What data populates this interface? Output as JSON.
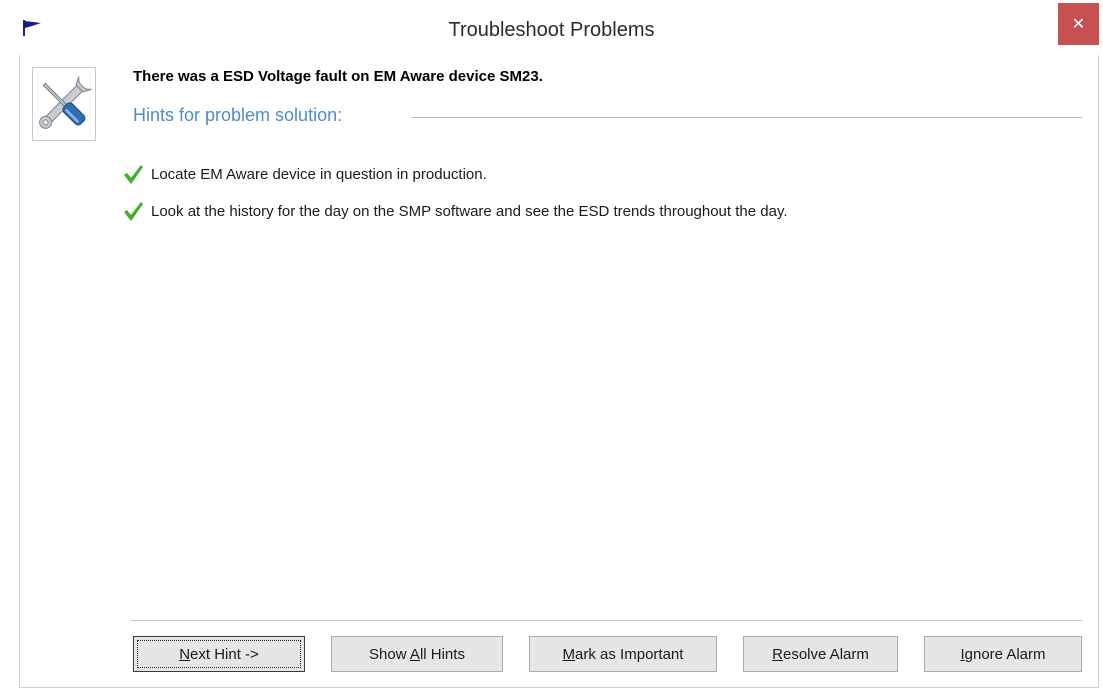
{
  "window": {
    "title": "Troubleshoot Problems",
    "close_glyph": "✕"
  },
  "icons": {
    "app": "flag-icon",
    "problem": "tools-icon",
    "hint_marker": "checkmark-icon"
  },
  "colors": {
    "hints_header": "#4f8cc9",
    "check": "#3fae2a",
    "close_bg": "#c75050",
    "flag": "#1a1a8c"
  },
  "problem": {
    "headline": "There was a ESD Voltage fault on EM Aware device SM23."
  },
  "hints": {
    "header": "Hints for problem solution:",
    "items": [
      "Locate EM Aware device in question in production.",
      "Look at the history for the day on the SMP software and see the ESD trends throughout the day."
    ]
  },
  "buttons": {
    "next_hint": {
      "pre": "",
      "key": "N",
      "post": "ext Hint ->"
    },
    "show_all_hints": {
      "pre": "Show ",
      "key": "A",
      "post": "ll Hints"
    },
    "mark_important": {
      "pre": "",
      "key": "M",
      "post": "ark as Important"
    },
    "resolve_alarm": {
      "pre": "",
      "key": "R",
      "post": "esolve Alarm"
    },
    "ignore_alarm": {
      "pre": "",
      "key": "I",
      "post": "gnore Alarm"
    }
  }
}
